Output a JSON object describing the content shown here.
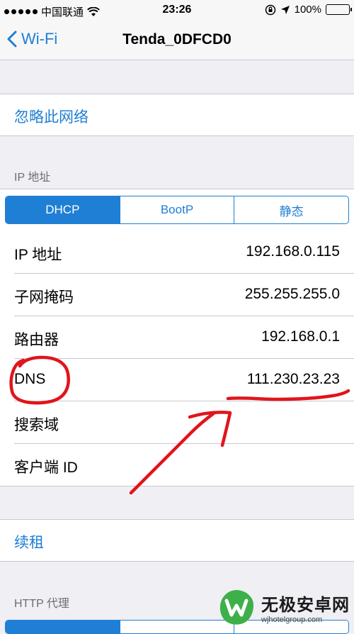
{
  "status_bar": {
    "carrier": "中国联通",
    "time": "23:26",
    "battery": "100%"
  },
  "nav": {
    "back_label": "Wi-Fi",
    "title": "Tenda_0DFCD0"
  },
  "forget_network": "忽略此网络",
  "ip_section": {
    "header": "IP 地址",
    "segments": [
      "DHCP",
      "BootP",
      "静态"
    ],
    "selected": "DHCP",
    "rows": [
      {
        "label": "IP 地址",
        "value": "192.168.0.115"
      },
      {
        "label": "子网掩码",
        "value": "255.255.255.0"
      },
      {
        "label": "路由器",
        "value": "192.168.0.1"
      },
      {
        "label": "DNS",
        "value": "111.230.23.23"
      },
      {
        "label": "搜索域",
        "value": ""
      },
      {
        "label": "客户端 ID",
        "value": ""
      }
    ]
  },
  "renew_lease": "续租",
  "http_proxy_header": "HTTP 代理",
  "watermark": {
    "title": "无极安卓网",
    "url": "wjhotelgroup.com"
  },
  "colors": {
    "accent": "#1f7fd4",
    "annotation": "#e0151b"
  }
}
